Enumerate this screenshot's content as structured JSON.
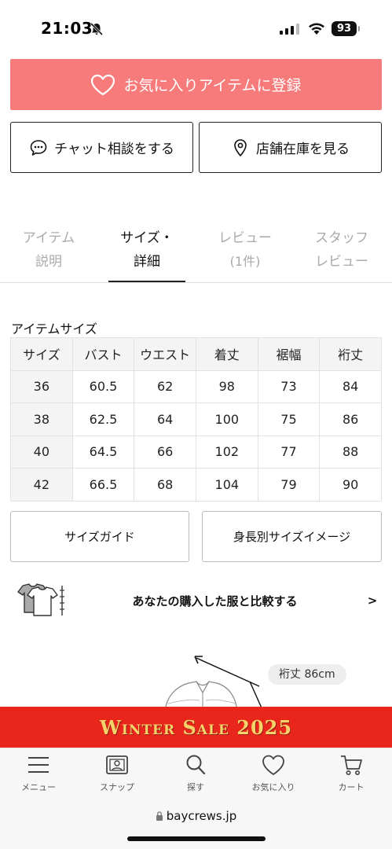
{
  "status": {
    "time": "21:03",
    "battery": "93"
  },
  "favorite": {
    "label": "お気に入りアイテムに登録"
  },
  "actions": {
    "chat_label": "チャット相談をする",
    "store_label": "店舗在庫を見る"
  },
  "tabs": [
    {
      "line1": "アイテム",
      "line2": "説明"
    },
    {
      "line1": "サイズ・",
      "line2": "詳細"
    },
    {
      "line1": "レビュー",
      "line2": "(1件)"
    },
    {
      "line1": "スタッフ",
      "line2": "レビュー"
    }
  ],
  "size_table": {
    "title": "アイテムサイズ",
    "headers": [
      "サイズ",
      "バスト",
      "ウエスト",
      "着丈",
      "裾幅",
      "裄丈"
    ],
    "rows": [
      [
        "36",
        "60.5",
        "62",
        "98",
        "73",
        "84"
      ],
      [
        "38",
        "62.5",
        "64",
        "100",
        "75",
        "86"
      ],
      [
        "40",
        "64.5",
        "66",
        "102",
        "77",
        "88"
      ],
      [
        "42",
        "66.5",
        "68",
        "104",
        "79",
        "90"
      ]
    ]
  },
  "guides": {
    "size_guide": "サイズガイド",
    "height_image": "身長別サイズイメージ"
  },
  "compare": {
    "label": "あなたの購入した服と比較する",
    "arrow": ">"
  },
  "diagram": {
    "measure_label": "裄丈 86cm"
  },
  "banner": {
    "text": "Winter Sale 2025"
  },
  "bottom_nav": [
    {
      "label": "メニュー",
      "icon": "menu-icon"
    },
    {
      "label": "スナップ",
      "icon": "snap-icon"
    },
    {
      "label": "探す",
      "icon": "search-icon"
    },
    {
      "label": "お気に入り",
      "icon": "heart-icon"
    },
    {
      "label": "カート",
      "icon": "cart-icon"
    }
  ],
  "browser": {
    "url": "baycrews.jp"
  },
  "colors": {
    "favorite_bg": "#f87b7b",
    "banner_bg": "#e8261c",
    "banner_text": "#f3d36a"
  }
}
